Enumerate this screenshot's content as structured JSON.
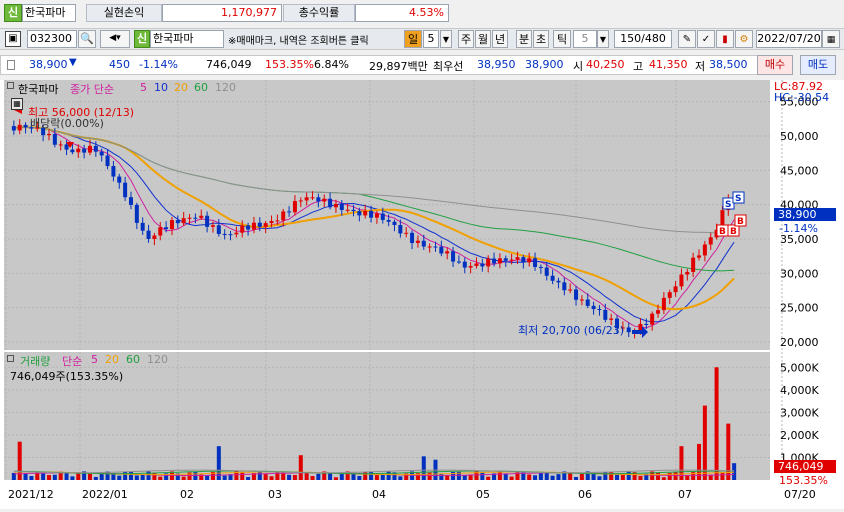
{
  "account": {
    "badge": "신",
    "name": "한국파마",
    "profit_label": "실현손익",
    "profit_value": "1,170,977",
    "yield_label": "총수익률",
    "yield_value": "4.53%"
  },
  "toolbar": {
    "code": "032300",
    "badge": "신",
    "name": "한국파마",
    "hint": "※매매마크, 내역은 조회버튼 클릭",
    "period_sel": "일",
    "period_num": "5",
    "tabs": [
      "주",
      "월",
      "년",
      "분",
      "초",
      "틱"
    ],
    "tick_num": "5",
    "count": "150/480",
    "date": "2022/07/20"
  },
  "quote": {
    "price": "38,900",
    "change": "450",
    "rate": "-1.14%",
    "volume": "746,049",
    "vol_rate": "153.35%",
    "turnover": "6.84%",
    "amount": "29,897백만",
    "best_label": "최우선",
    "best_ask": "38,950",
    "best_bid": "38,900",
    "open_label": "시",
    "open": "40,250",
    "high_label": "고",
    "high": "41,350",
    "low_label": "저",
    "low": "38,500",
    "buy": "매수",
    "sell": "매도"
  },
  "price_panel": {
    "title": "한국파마",
    "ma_label": "종가 단순",
    "ma": [
      "5",
      "10",
      "20",
      "60",
      "120"
    ],
    "ma_colors": [
      "#d020a0",
      "#1030d0",
      "#f0a000",
      "#20a040",
      "#909090"
    ],
    "high_note": "최고 56,000 (12/13)",
    "div_note": "배당락(0.00%)",
    "low_note": "최저 20,700 (06/23)",
    "lc": "LC:87.92",
    "hc": "HC:-30.54",
    "cur_price": "38,900",
    "cur_rate": "-1.14%",
    "y_ticks": [
      "55,000",
      "50,000",
      "45,000",
      "40,000",
      "35,000",
      "30,000",
      "25,000",
      "20,000"
    ],
    "marks": [
      "S",
      "S",
      "B",
      "B",
      "B"
    ]
  },
  "vol_panel": {
    "title": "거래량",
    "ma_label": "단순",
    "ma": [
      "5",
      "20",
      "60",
      "120"
    ],
    "ma_colors": [
      "#d020a0",
      "#f0a000",
      "#20a040",
      "#909090"
    ],
    "value_note": "746,049주(153.35%)",
    "y_ticks": [
      "5,000K",
      "4,000K",
      "3,000K",
      "2,000K",
      "1,000K"
    ],
    "cur": "746,049",
    "cur_rate": "153.35%"
  },
  "x_axis": [
    "2021/12",
    "2022/01",
    "02",
    "03",
    "04",
    "05",
    "06",
    "07",
    "07/20"
  ],
  "chart_data": {
    "type": "candlestick",
    "title": "한국파마",
    "dates": [
      "2021/12",
      "2022/01",
      "02",
      "03",
      "04",
      "05",
      "06",
      "07"
    ],
    "close": [
      51000,
      48000,
      38000,
      36000,
      40000,
      33000,
      23000,
      38900
    ],
    "high": 56000,
    "low": 20700,
    "ylim": [
      20000,
      57000
    ],
    "volume_ylim": [
      0,
      5500000
    ]
  }
}
